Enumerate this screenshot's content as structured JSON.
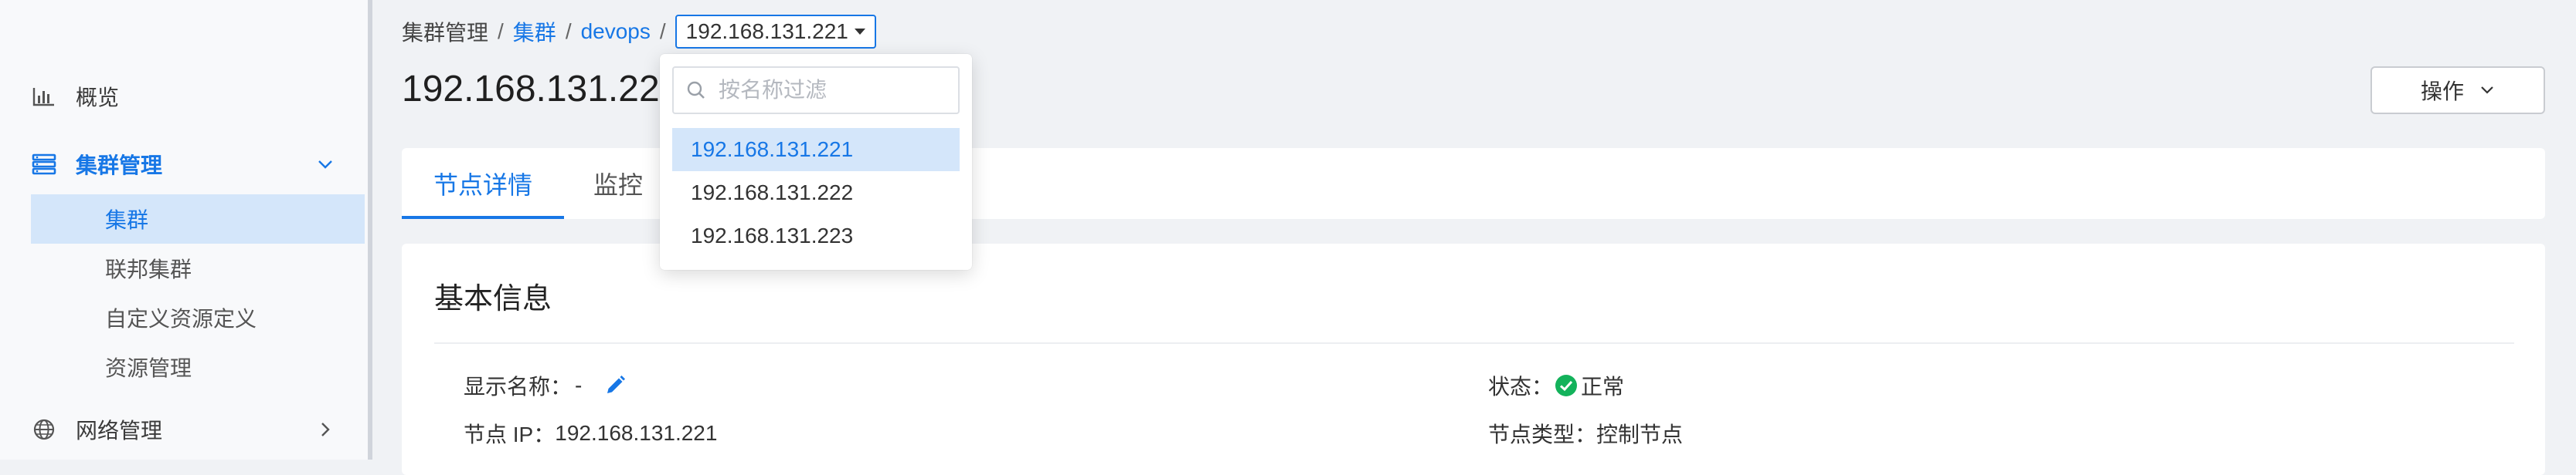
{
  "sidebar": {
    "overview": {
      "label": "概览",
      "icon": "bar-chart-icon"
    },
    "cluster_mgmt": {
      "label": "集群管理",
      "icon": "server-stack-icon"
    },
    "sub_items": [
      "集群",
      "联邦集群",
      "自定义资源定义",
      "资源管理"
    ],
    "network_mgmt": {
      "label": "网络管理",
      "icon": "globe-icon"
    }
  },
  "breadcrumb": {
    "root": "集群管理",
    "cluster": "集群",
    "name": "devops",
    "node": "192.168.131.221"
  },
  "page": {
    "title": "192.168.131.221",
    "action_label": "操作"
  },
  "tabs": [
    "节点详情",
    "监控"
  ],
  "dropdown": {
    "placeholder": "按名称过滤",
    "options": [
      "192.168.131.221",
      "192.168.131.222",
      "192.168.131.223"
    ],
    "selected": "192.168.131.221"
  },
  "basic_info": {
    "title": "基本信息",
    "display_name_label": "显示名称：",
    "display_name_value": "-",
    "node_ip_label": "节点 IP：",
    "node_ip_value": "192.168.131.221",
    "status_label": "状态：",
    "status_value": "正常",
    "node_type_label": "节点类型：",
    "node_type_value": "控制节点"
  },
  "colors": {
    "accent": "#1777e6",
    "status_ok": "#13b25b",
    "selected_bg": "#d4e6fa"
  }
}
